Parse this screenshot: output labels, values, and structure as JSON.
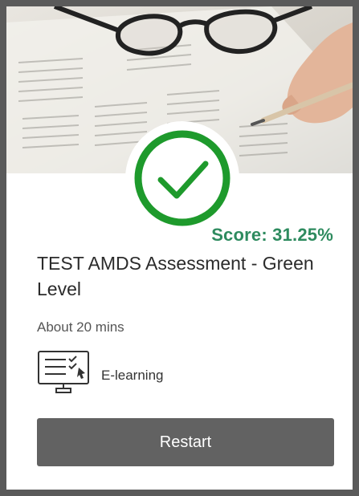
{
  "card": {
    "score_text": "Score: 31.25%",
    "title": "TEST AMDS Assessment - Green Level",
    "duration": "About 20 mins",
    "type_label": "E-learning",
    "type_icon": "elearning-monitor-icon",
    "status_icon": "checkmark-circle-icon",
    "restart_label": "Restart"
  },
  "colors": {
    "accent_green": "#2e8b5f",
    "check_green": "#1e9a2c",
    "button_bg": "#626262"
  }
}
